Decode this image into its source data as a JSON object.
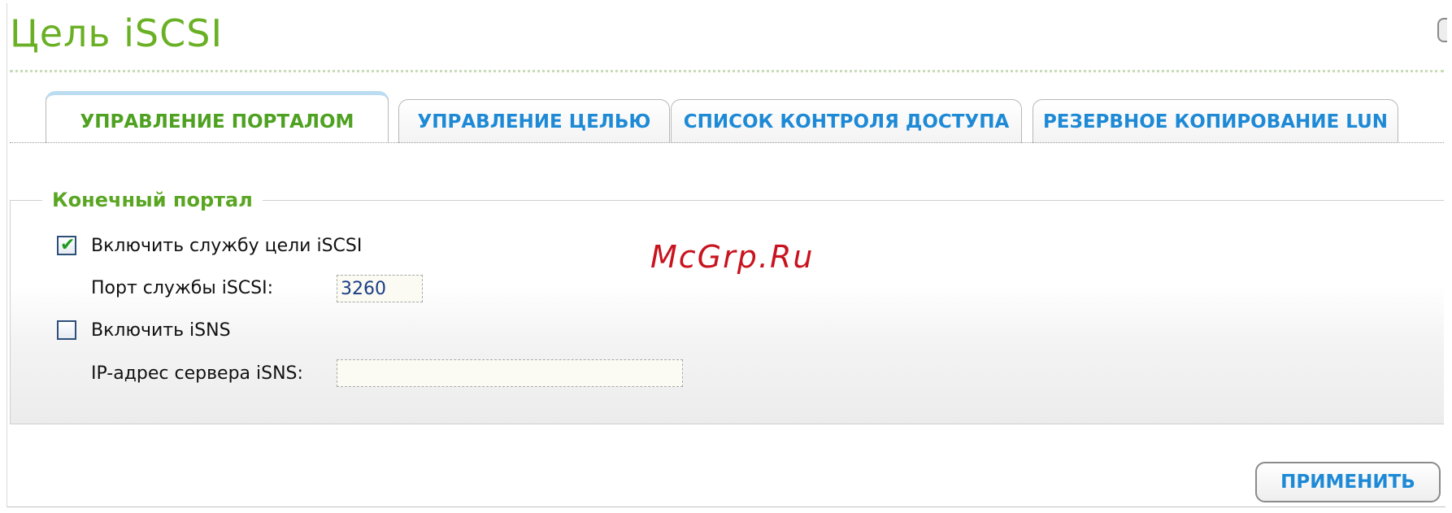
{
  "page": {
    "title": "Цель iSCSI"
  },
  "tabs": [
    {
      "label": "УПРАВЛЕНИЕ ПОРТАЛОМ",
      "active": true
    },
    {
      "label": "УПРАВЛЕНИЕ ЦЕЛЬЮ",
      "active": false
    },
    {
      "label": "СПИСОК КОНТРОЛЯ ДОСТУПА",
      "active": false
    },
    {
      "label": "РЕЗЕРВНОЕ КОПИРОВАНИЕ LUN",
      "active": false
    }
  ],
  "portal": {
    "legend": "Конечный портал",
    "enable_service_label": "Включить службу цели iSCSI",
    "enable_service_checked": true,
    "port_label": "Порт службы iSCSI:",
    "port_value": "3260",
    "enable_isns_label": "Включить iSNS",
    "enable_isns_checked": false,
    "isns_server_label": "IP-адрес сервера iSNS:",
    "isns_server_value": ""
  },
  "watermark": "McGrp.Ru",
  "actions": {
    "apply_label": "ПРИМЕНИТЬ"
  },
  "colors": {
    "title_green": "#6ab024",
    "active_tab_green": "#4ea121",
    "tab_blue": "#1e8ad6",
    "watermark_red": "#c8141e"
  }
}
